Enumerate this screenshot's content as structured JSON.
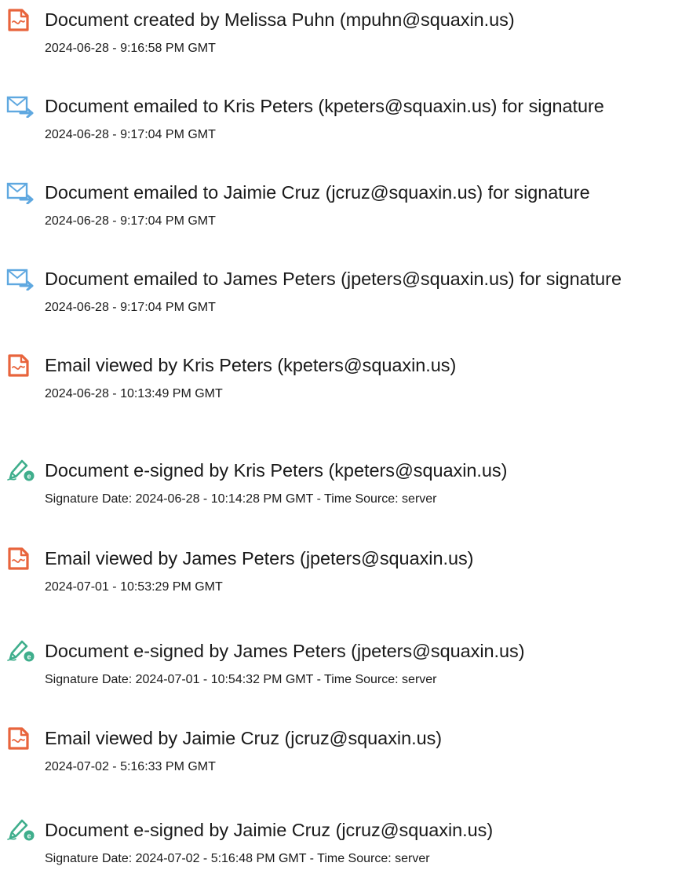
{
  "events": [
    {
      "icon": "document-created-icon",
      "title": "Document created by Melissa Puhn (mpuhn@squaxin.us)",
      "detail": "2024-06-28 - 9:16:58 PM GMT"
    },
    {
      "icon": "email-sent-icon",
      "title": "Document emailed to Kris Peters (kpeters@squaxin.us) for signature",
      "detail": "2024-06-28 - 9:17:04 PM GMT"
    },
    {
      "icon": "email-sent-icon",
      "title": "Document emailed to Jaimie Cruz (jcruz@squaxin.us) for signature",
      "detail": "2024-06-28 - 9:17:04 PM GMT"
    },
    {
      "icon": "email-sent-icon",
      "title": "Document emailed to James Peters (jpeters@squaxin.us) for signature",
      "detail": "2024-06-28 - 9:17:04 PM GMT"
    },
    {
      "icon": "document-viewed-icon",
      "title": "Email viewed by Kris Peters (kpeters@squaxin.us)",
      "detail": "2024-06-28 - 10:13:49 PM GMT"
    },
    {
      "icon": "e-signed-pen-icon",
      "title": "Document e-signed by Kris Peters (kpeters@squaxin.us)",
      "detail": "Signature Date: 2024-06-28 - 10:14:28 PM GMT - Time Source: server"
    },
    {
      "icon": "document-viewed-icon",
      "title": "Email viewed by James Peters (jpeters@squaxin.us)",
      "detail": "2024-07-01 - 10:53:29 PM GMT"
    },
    {
      "icon": "e-signed-pen-icon",
      "title": "Document e-signed by James Peters (jpeters@squaxin.us)",
      "detail": "Signature Date: 2024-07-01 - 10:54:32 PM GMT - Time Source: server"
    },
    {
      "icon": "document-viewed-icon",
      "title": "Email viewed by Jaimie Cruz (jcruz@squaxin.us)",
      "detail": "2024-07-02 - 5:16:33 PM GMT"
    },
    {
      "icon": "e-signed-pen-icon",
      "title": "Document e-signed by Jaimie Cruz (jcruz@squaxin.us)",
      "detail": "Signature Date: 2024-07-02 - 5:16:48 PM GMT - Time Source: server"
    }
  ],
  "colors": {
    "document_icon": "#e8643c",
    "email_icon": "#5fa8e0",
    "sign_icon": "#3fae8c",
    "text": "#1a1a1a"
  }
}
